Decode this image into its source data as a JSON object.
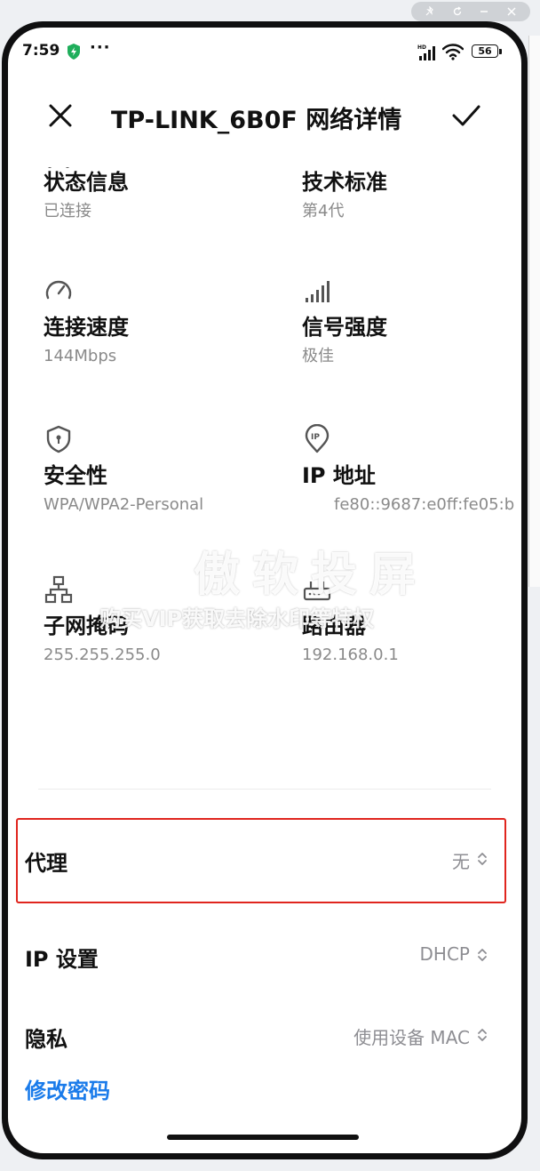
{
  "status_bar": {
    "time": "7:59",
    "more": "···",
    "network_tag": "HD",
    "battery": "56"
  },
  "header": {
    "title": "TP-LINK_6B0F 网络详情"
  },
  "details": [
    {
      "label": "状态信息",
      "value": "已连接",
      "icon": "status-icon"
    },
    {
      "label": "技术标准",
      "value": "第4代",
      "icon": "wifi-standard-icon"
    },
    {
      "label": "连接速度",
      "value": "144Mbps",
      "icon": "speedometer-icon"
    },
    {
      "label": "信号强度",
      "value": "极佳",
      "icon": "signal-bars-icon"
    },
    {
      "label": "安全性",
      "value": "WPA/WPA2-Personal",
      "icon": "shield-lock-icon"
    },
    {
      "label": "IP 地址",
      "value": "fe80::9687:e0ff:fe05:b",
      "icon": "ip-pin-icon"
    },
    {
      "label": "子网掩码",
      "value": "255.255.255.0",
      "icon": "network-tree-icon"
    },
    {
      "label": "路由器",
      "value": "192.168.0.1",
      "icon": "router-icon"
    }
  ],
  "settings": {
    "proxy": {
      "label": "代理",
      "value": "无"
    },
    "ip_settings": {
      "label": "IP 设置",
      "value": "DHCP"
    },
    "privacy": {
      "label": "隐私",
      "value": "使用设备 MAC"
    },
    "change_password": "修改密码"
  },
  "watermark": {
    "title": "傲软投屏",
    "subtitle": "购买VIP获取去除水印等特权"
  },
  "colors": {
    "accent_link": "#1a7bea",
    "highlight_border": "#e0251e",
    "secondary_text": "#8a8a8a"
  }
}
